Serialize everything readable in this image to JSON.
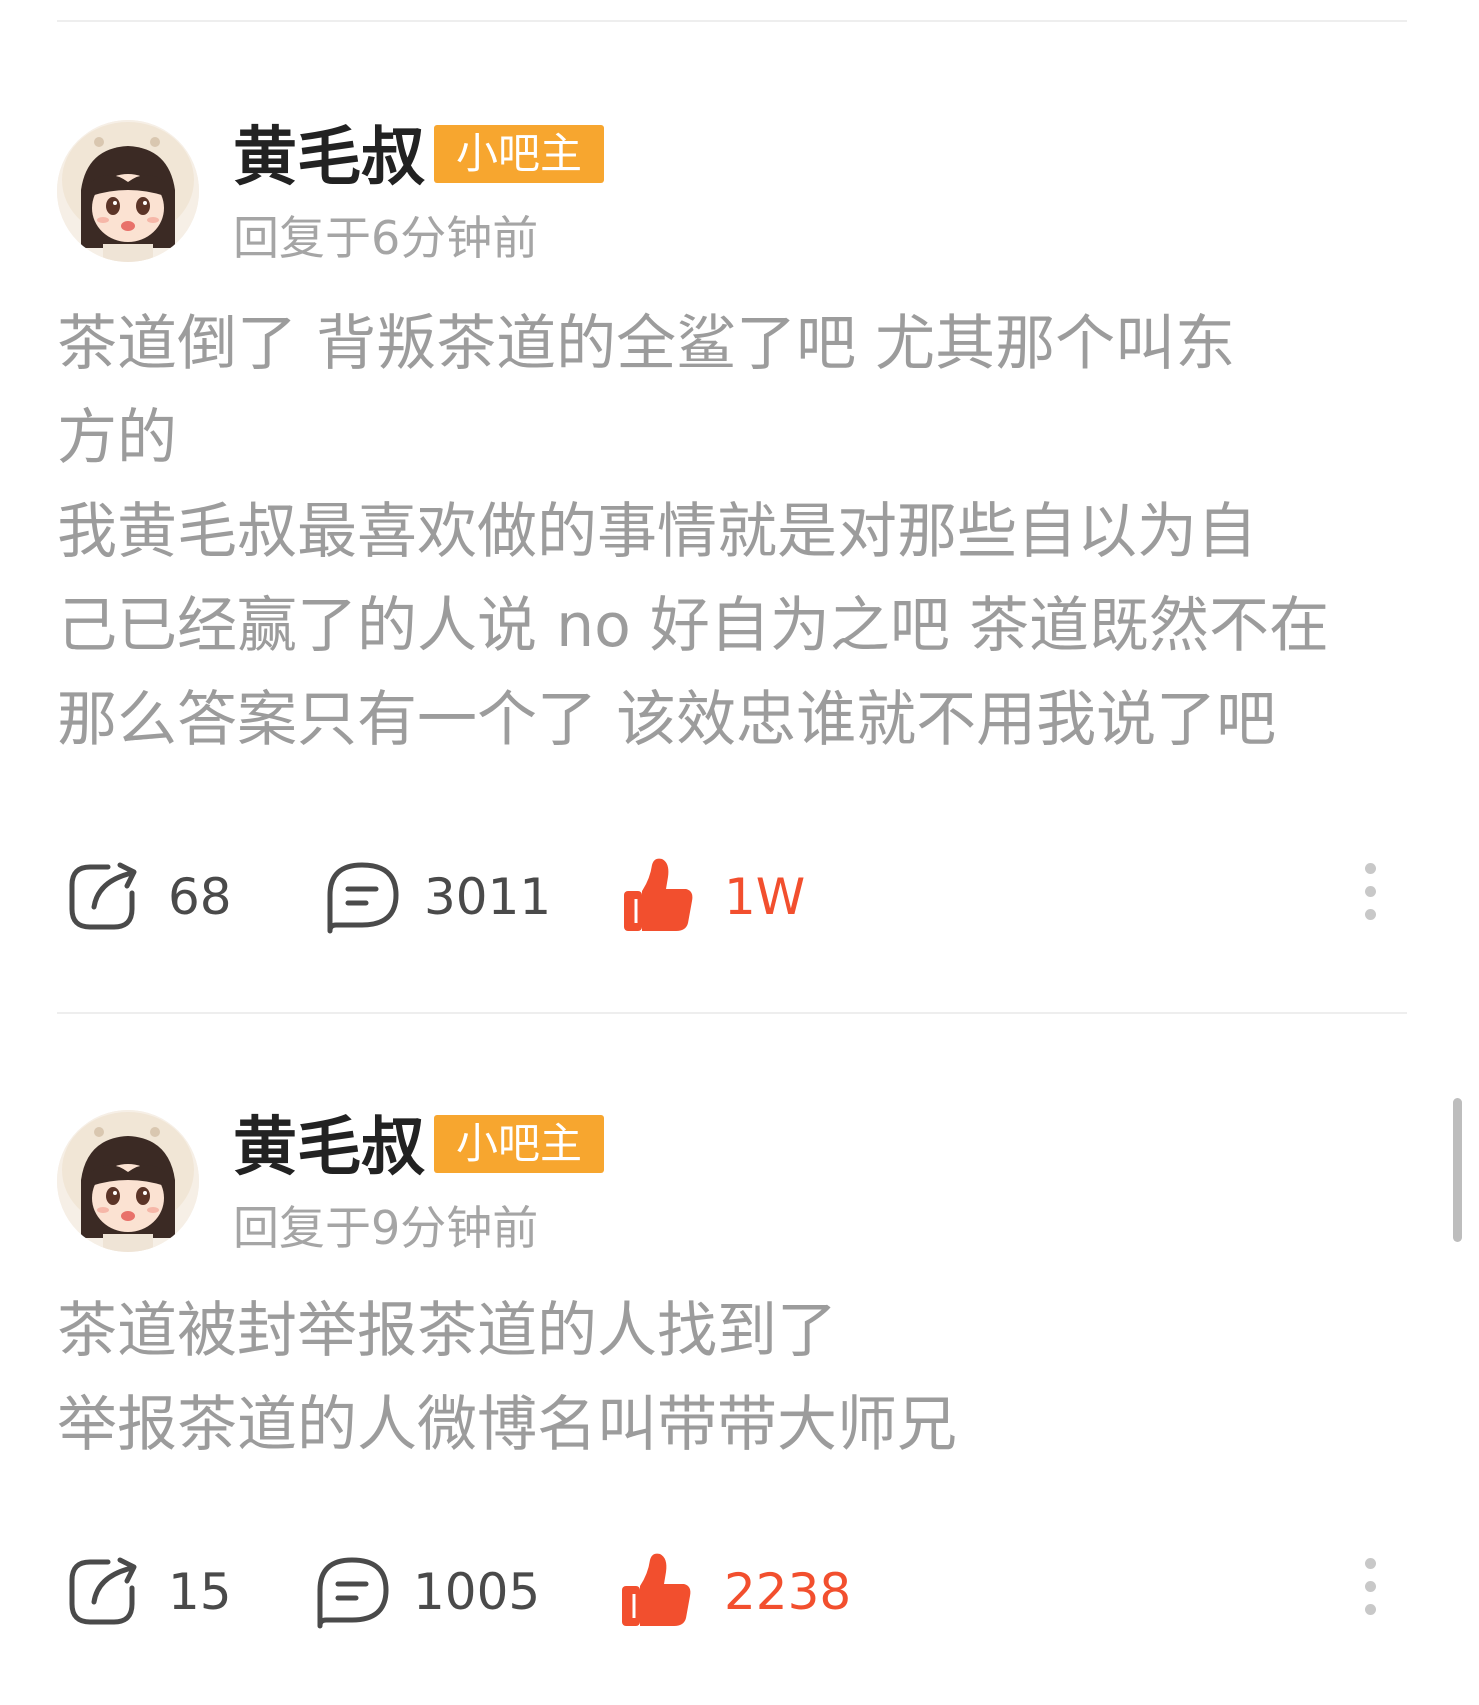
{
  "posts": [
    {
      "username": "黄毛叔",
      "badge": "小吧主",
      "reply_time": "回复于6分钟前",
      "content_lines": [
        "茶道倒了  背叛茶道的全鲨了吧   尤其那个叫东",
        "方的",
        "我黄毛叔最喜欢做的事情就是对那些自以为自",
        "己已经赢了的人说 no 好自为之吧 茶道既然不在",
        "那么答案只有一个了 该效忠谁就不用我说了吧"
      ],
      "share_count": "68",
      "comment_count": "3011",
      "like_count": "1W"
    },
    {
      "username": "黄毛叔",
      "badge": "小吧主",
      "reply_time": "回复于9分钟前",
      "content_lines": [
        "茶道被封举报茶道的人找到了",
        "举报茶道的人微博名叫带带大师兄"
      ],
      "share_count": "15",
      "comment_count": "1005",
      "like_count": "2238"
    }
  ],
  "colors": {
    "badge": "#f7a62f",
    "like": "#f24f2e",
    "content_text": "#9c9c9c",
    "meta_text": "#a5a5a5"
  },
  "icons": {
    "share": "share-arrow-icon",
    "comment": "comment-bubble-icon",
    "like": "thumbs-up-icon",
    "more": "more-vertical-icon"
  }
}
